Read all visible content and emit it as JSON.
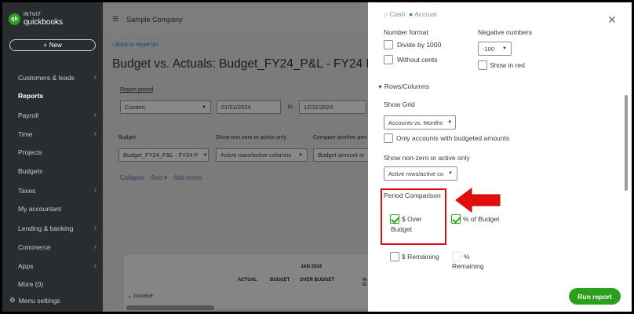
{
  "app": {
    "brand_line1": "INTUIT",
    "brand_line2": "quickbooks",
    "company": "Sample Company"
  },
  "sidebar": {
    "new_label": "New",
    "items": [
      {
        "label": "Customers & leads",
        "chevron": true
      },
      {
        "label": "Reports",
        "chevron": false,
        "active": true
      },
      {
        "label": "Payroll",
        "chevron": true
      },
      {
        "label": "Time",
        "chevron": true
      },
      {
        "label": "Projects",
        "chevron": false
      },
      {
        "label": "Budgets",
        "chevron": false
      },
      {
        "label": "Taxes",
        "chevron": true
      },
      {
        "label": "My accountant",
        "chevron": false
      },
      {
        "label": "Lending & banking",
        "chevron": true
      },
      {
        "label": "Commerce",
        "chevron": true
      },
      {
        "label": "Apps",
        "chevron": true
      },
      {
        "label": "More (0)",
        "chevron": false
      }
    ],
    "menu_settings": "Menu settings"
  },
  "main": {
    "back_link": "Back to report list",
    "title": "Budget vs. Actuals: Budget_FY24_P&L - FY24 P&L F",
    "report_period_label": "Report period",
    "period_value": "Custom",
    "date_from": "01/01/2024",
    "to_label": "to",
    "date_to": "12/31/2024",
    "budget_label": "Budget",
    "budget_value": "Budget_FY24_P&L - FY24 P",
    "nonzero_label": "Show non zero or active only",
    "nonzero_value": "Active rows/active columns",
    "compare_label": "Compare another peri",
    "compare_value": "Budget amount or",
    "collapse": "Collapse",
    "sort": "Sort",
    "add_notes": "Add notes",
    "table": {
      "period": "JAN 2024",
      "columns": [
        "ACTUAL",
        "BUDGET",
        "OVER BUDGET",
        "% O"
      ],
      "first_row": "Income"
    }
  },
  "panel": {
    "top_radio_partial": [
      "Cash",
      "Accrual"
    ],
    "number_format": "Number format",
    "divide_1000": "Divide by 1000",
    "without_cents": "Without cents",
    "negative_numbers": "Negative numbers",
    "negative_value": "-100",
    "show_in_red": "Show in red",
    "rows_columns": "Rows/Columns",
    "show_grid": "Show Grid",
    "grid_value": "Accounts vs. Months",
    "only_budgeted": "Only accounts with budgeted amounts",
    "show_nonzero": "Show non-zero or active only",
    "nonzero_value": "Active rows/active co",
    "period_comparison": "Period Comparison",
    "over_budget_l1": "$ Over",
    "over_budget_l2": "Budget",
    "pct_budget": "% of Budget",
    "remaining": "$ Remaining",
    "pct_remaining_l1": "%",
    "pct_remaining_l2": "Remaining",
    "run_report": "Run report",
    "checks": {
      "over_budget": true,
      "pct_budget": true,
      "remaining": false,
      "pct_remaining": false
    },
    "accent": "#2ca01c",
    "highlight": "#e30d0d"
  }
}
